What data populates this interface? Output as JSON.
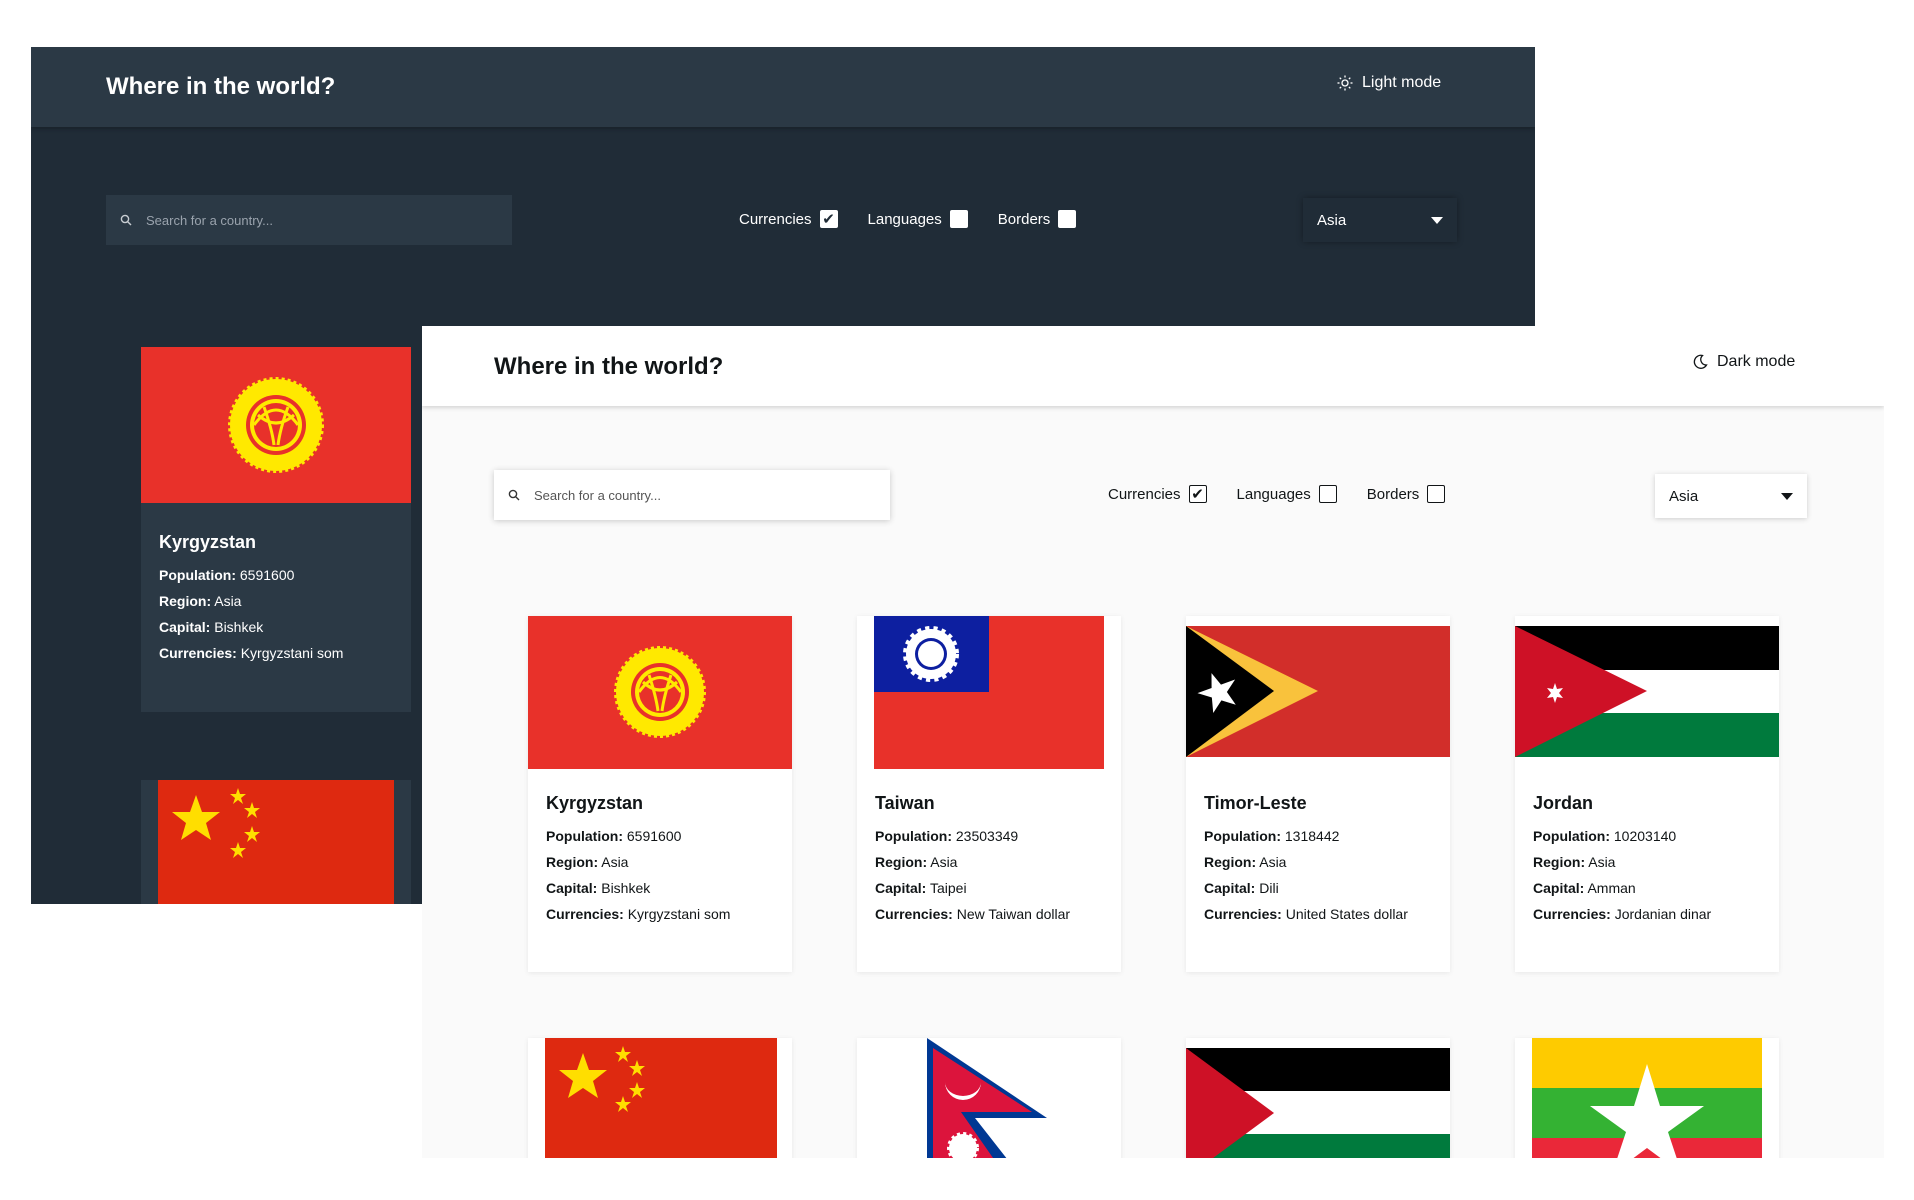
{
  "dark": {
    "title": "Where in the world?",
    "mode_label": "Light mode",
    "mode_icon": "sun-icon",
    "search_placeholder": "Search for a country...",
    "filters": [
      {
        "label": "Currencies",
        "checked": true
      },
      {
        "label": "Languages",
        "checked": false
      },
      {
        "label": "Borders",
        "checked": false
      }
    ],
    "region": "Asia",
    "card": {
      "name": "Kyrgyzstan",
      "population_label": "Population:",
      "population": "6591600",
      "region_label": "Region:",
      "region": "Asia",
      "capital_label": "Capital:",
      "capital": "Bishkek",
      "currencies_label": "Currencies:",
      "currencies": "Kyrgyzstani som"
    }
  },
  "light": {
    "title": "Where in the world?",
    "mode_label": "Dark mode",
    "mode_icon": "moon-icon",
    "search_placeholder": "Search for a country...",
    "filters": [
      {
        "label": "Currencies",
        "checked": true
      },
      {
        "label": "Languages",
        "checked": false
      },
      {
        "label": "Borders",
        "checked": false
      }
    ],
    "region": "Asia",
    "labels": {
      "population": "Population:",
      "region": "Region:",
      "capital": "Capital:",
      "currencies": "Currencies:"
    },
    "cards": [
      {
        "name": "Kyrgyzstan",
        "population": "6591600",
        "region": "Asia",
        "capital": "Bishkek",
        "currencies": "Kyrgyzstani som",
        "flag": "kyrgyzstan-flag"
      },
      {
        "name": "Taiwan",
        "population": "23503349",
        "region": "Asia",
        "capital": "Taipei",
        "currencies": "New Taiwan dollar",
        "flag": "taiwan-flag"
      },
      {
        "name": "Timor-Leste",
        "population": "1318442",
        "region": "Asia",
        "capital": "Dili",
        "currencies": "United States dollar",
        "flag": "timor-leste-flag"
      },
      {
        "name": "Jordan",
        "population": "10203140",
        "region": "Asia",
        "capital": "Amman",
        "currencies": "Jordanian dinar",
        "flag": "jordan-flag"
      }
    ],
    "second_row_flags": [
      "china-flag",
      "nepal-flag",
      "palestine-flag",
      "myanmar-flag"
    ]
  },
  "colors": {
    "dark_bg": "#202c37",
    "dark_element": "#2b3945",
    "light_bg": "#fafafa",
    "light_element": "#ffffff",
    "light_text": "#111517"
  }
}
